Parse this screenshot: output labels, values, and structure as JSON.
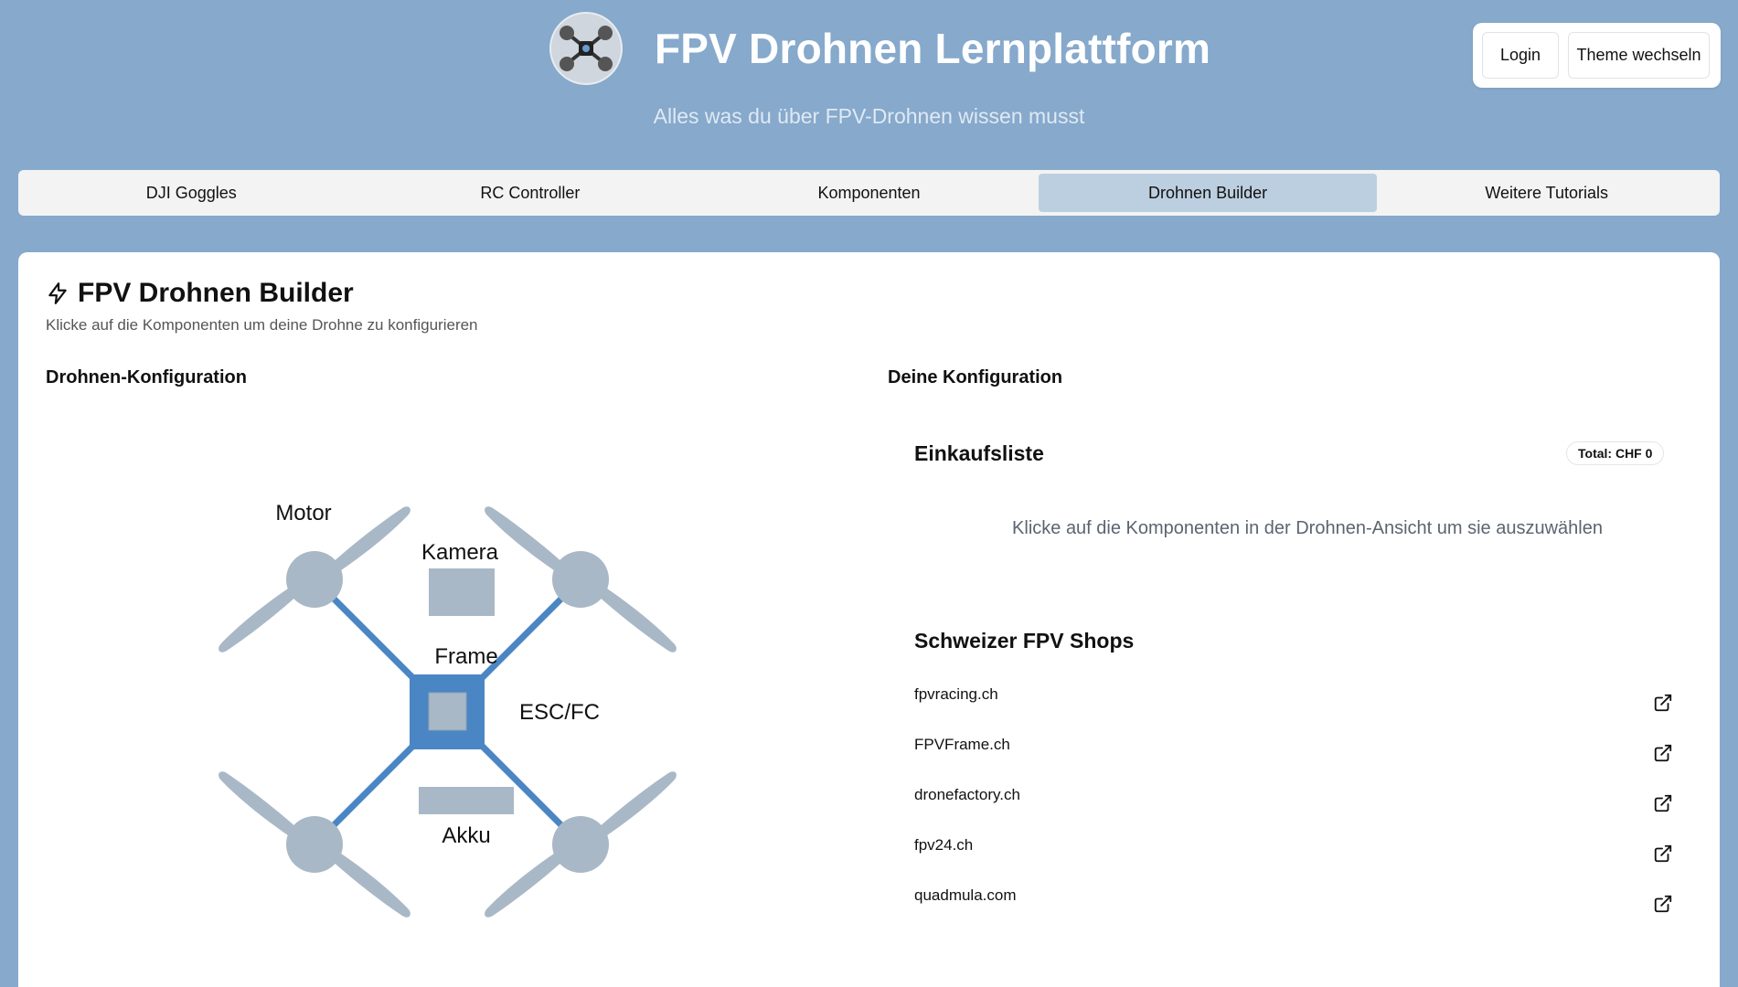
{
  "header": {
    "title": "FPV Drohnen Lernplattform",
    "subtitle": "Alles was du über FPV-Drohnen wissen musst",
    "logo_icon": "drone-logo-icon",
    "login_label": "Login",
    "theme_label": "Theme wechseln"
  },
  "nav": {
    "tabs": [
      {
        "label": "DJI Goggles",
        "active": false
      },
      {
        "label": "RC Controller",
        "active": false
      },
      {
        "label": "Komponenten",
        "active": false
      },
      {
        "label": "Drohnen Builder",
        "active": true
      },
      {
        "label": "Weitere Tutorials",
        "active": false
      }
    ]
  },
  "builder": {
    "title": "FPV Drohnen Builder",
    "title_icon": "lightning-bolt-icon",
    "description": "Klicke auf die Komponenten um deine Drohne zu konfigurieren",
    "left_heading": "Drohnen-Konfiguration",
    "right_heading": "Deine Konfiguration",
    "diagram": {
      "motor": "Motor",
      "camera": "Kamera",
      "frame": "Frame",
      "esc_fc": "ESC/FC",
      "battery": "Akku"
    },
    "shopping": {
      "title": "Einkaufsliste",
      "total": "Total: CHF 0",
      "empty_hint": "Klicke auf die Komponenten in der Drohnen-Ansicht um sie auszuwählen"
    },
    "shops": {
      "title": "Schweizer FPV Shops",
      "items": [
        "fpvracing.ch",
        "FPVFrame.ch",
        "dronefactory.ch",
        "fpv24.ch",
        "quadmula.com"
      ]
    }
  },
  "colors": {
    "page_bg": "#86a9cc",
    "frame_blue": "#4a86c3",
    "part_gray": "#a9b8c6",
    "active_tab": "#bccfe0"
  }
}
